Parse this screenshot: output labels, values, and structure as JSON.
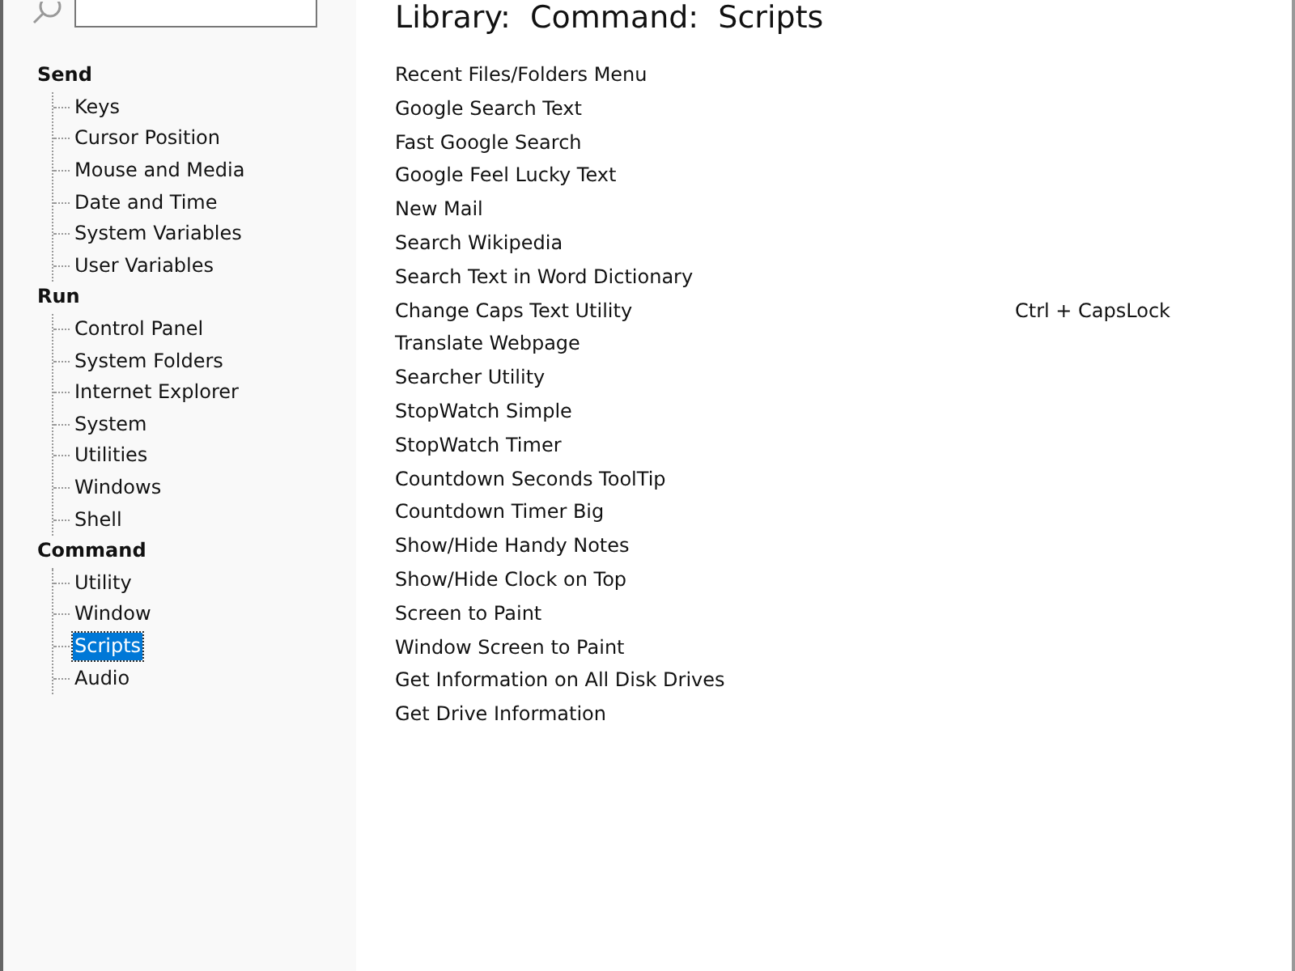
{
  "sidebar": {
    "tree": [
      {
        "label": "Send",
        "children": [
          {
            "label": "Keys",
            "selected": false
          },
          {
            "label": "Cursor Position",
            "selected": false
          },
          {
            "label": "Mouse and Media",
            "selected": false
          },
          {
            "label": "Date and Time",
            "selected": false
          },
          {
            "label": "System Variables",
            "selected": false
          },
          {
            "label": "User Variables",
            "selected": false
          }
        ]
      },
      {
        "label": "Run",
        "children": [
          {
            "label": "Control Panel",
            "selected": false
          },
          {
            "label": "System Folders",
            "selected": false
          },
          {
            "label": "Internet Explorer",
            "selected": false
          },
          {
            "label": "System",
            "selected": false
          },
          {
            "label": "Utilities",
            "selected": false
          },
          {
            "label": "Windows",
            "selected": false
          },
          {
            "label": "Shell",
            "selected": false
          }
        ]
      },
      {
        "label": "Command",
        "children": [
          {
            "label": "Utility",
            "selected": false
          },
          {
            "label": "Window",
            "selected": false
          },
          {
            "label": "Scripts",
            "selected": true
          },
          {
            "label": "Audio",
            "selected": false
          }
        ]
      }
    ]
  },
  "content": {
    "title": "Library:  Command:  Scripts",
    "items": [
      {
        "name": "Recent Files/Folders Menu"
      },
      {
        "name": "Google Search Text"
      },
      {
        "name": "Fast Google Search"
      },
      {
        "name": "Google Feel Lucky Text"
      },
      {
        "name": "New Mail"
      },
      {
        "name": "Search Wikipedia"
      },
      {
        "name": "Search Text in Word Dictionary"
      },
      {
        "name": "Change Caps Text Utility",
        "shortcut": "Ctrl + CapsLock"
      },
      {
        "name": "Translate Webpage"
      },
      {
        "name": "Searcher Utility"
      },
      {
        "name": "StopWatch Simple"
      },
      {
        "name": "StopWatch Timer"
      },
      {
        "name": "Countdown Seconds ToolTip"
      },
      {
        "name": "Countdown Timer Big"
      },
      {
        "name": "Show/Hide Handy Notes"
      },
      {
        "name": "Show/Hide Clock on Top"
      },
      {
        "name": "Screen to Paint"
      },
      {
        "name": "Window Screen to Paint"
      },
      {
        "name": "Get Information on All Disk Drives"
      },
      {
        "name": "Get Drive Information"
      }
    ]
  }
}
